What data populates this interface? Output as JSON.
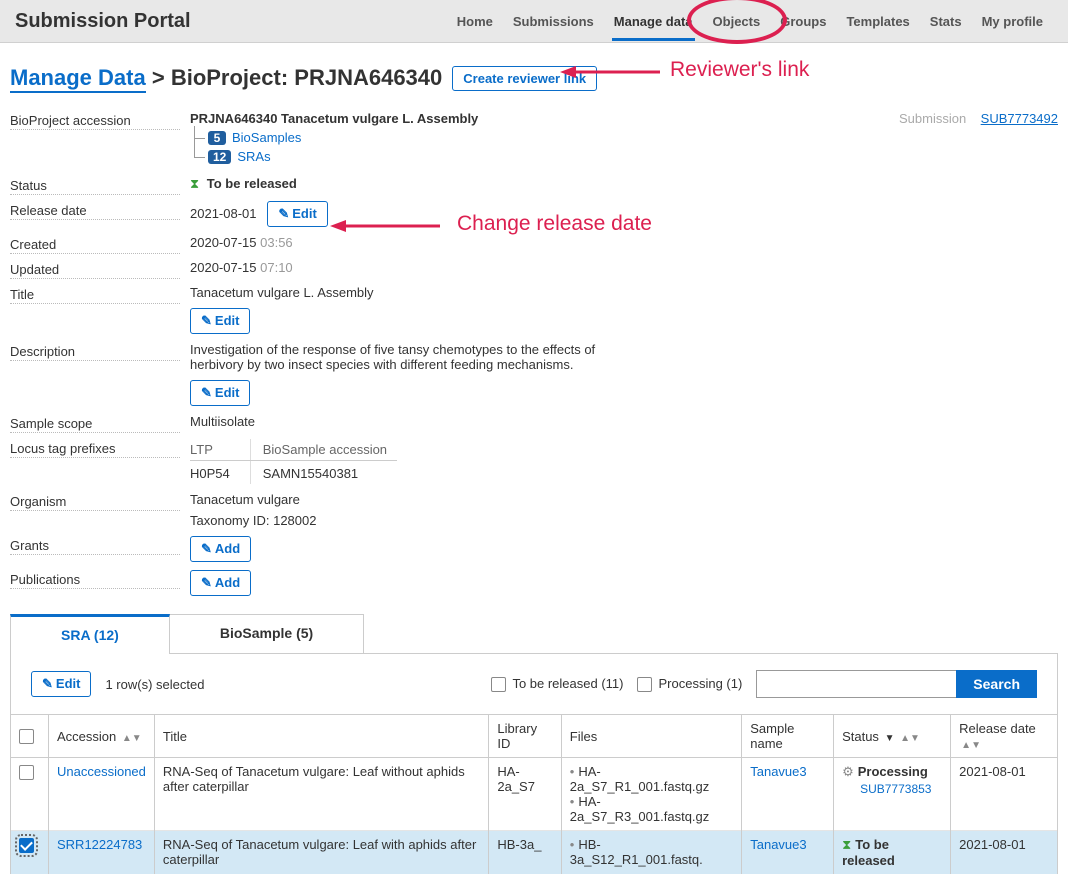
{
  "topbar": {
    "title": "Submission Portal"
  },
  "topnav": {
    "items": [
      "Home",
      "Submissions",
      "Manage data",
      "Objects",
      "Groups",
      "Templates",
      "Stats",
      "My profile"
    ],
    "active_index": 2
  },
  "annotations": {
    "reviewer_link_label": "Reviewer's link",
    "release_date_label": "Change release date"
  },
  "breadcrumb": {
    "root": "Manage Data",
    "sep": ">",
    "detail": "BioProject: PRJNA646340",
    "button": "Create reviewer link"
  },
  "details": {
    "accession_label": "BioProject accession",
    "accession_title": "PRJNA646340   Tanacetum vulgare L. Assembly",
    "biosamples_count": "5",
    "biosamples_label": "BioSamples",
    "sras_count": "12",
    "sras_label": "SRAs",
    "submission_side_label": "Submission",
    "submission_side_link": "SUB7773492",
    "status_label": "Status",
    "status_value": "To be released",
    "release_label": "Release date",
    "release_value": "2021-08-01",
    "edit_btn": "Edit",
    "created_label": "Created",
    "created_date": "2020-07-15",
    "created_time": "03:56",
    "updated_label": "Updated",
    "updated_date": "2020-07-15",
    "updated_time": "07:10",
    "title_label": "Title",
    "title_value": "Tanacetum vulgare L. Assembly",
    "description_label": "Description",
    "description_value": "Investigation of the response of five tansy chemotypes to the effects of herbivory by two insect species with different feeding mechanisms.",
    "scope_label": "Sample scope",
    "scope_value": "Multiisolate",
    "ltp_label": "Locus tag prefixes",
    "ltp_col1": "LTP",
    "ltp_col2": "BioSample accession",
    "ltp_val1": "H0P54",
    "ltp_val2": "SAMN15540381",
    "organism_label": "Organism",
    "organism_value": "Tanacetum vulgare",
    "taxonomy_value": "Taxonomy ID: 128002",
    "grants_label": "Grants",
    "publications_label": "Publications",
    "add_btn": "Add"
  },
  "tabs": {
    "sra": "SRA (12)",
    "biosample": "BioSample (5)"
  },
  "toolbar": {
    "edit": "Edit",
    "rows_selected": "1 row(s) selected",
    "filter_released": "To be released (11)",
    "filter_processing": "Processing (1)",
    "search_btn": "Search"
  },
  "table": {
    "headers": {
      "accession": "Accession",
      "title": "Title",
      "library": "Library ID",
      "files": "Files",
      "sample": "Sample name",
      "status": "Status",
      "release": "Release date"
    },
    "rows": [
      {
        "selected": false,
        "accession": "Unaccessioned",
        "title": "RNA-Seq of Tanacetum vulgare: Leaf without aphids after caterpillar",
        "library": "HA-2a_S7",
        "files": [
          "HA-2a_S7_R1_001.fastq.gz",
          "HA-2a_S7_R3_001.fastq.gz"
        ],
        "sample": "Tanavue3",
        "status_icon": "gear",
        "status": "Processing",
        "status_sub": "SUB7773853",
        "release": "2021-08-01"
      },
      {
        "selected": true,
        "accession": "SRR12224783",
        "title": "RNA-Seq of Tanacetum vulgare: Leaf with aphids after caterpillar",
        "library": "HB-3a_",
        "files": [
          "HB-3a_S12_R1_001.fastq."
        ],
        "sample": "Tanavue3",
        "status_icon": "hourglass",
        "status": "To be released",
        "status_sub": "",
        "release": "2021-08-01"
      }
    ]
  }
}
